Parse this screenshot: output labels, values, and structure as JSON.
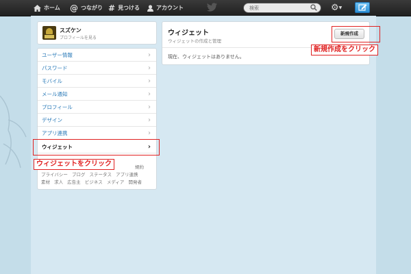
{
  "topbar": {
    "home_label": "ホーム",
    "connect_label": "つながり",
    "discover_label": "見つける",
    "account_label": "アカウント",
    "search_placeholder": "検索"
  },
  "profile": {
    "name": "スズケン",
    "link": "プロフィールを見る"
  },
  "menu": {
    "items": [
      {
        "label": "ユーザー情報"
      },
      {
        "label": "パスワード"
      },
      {
        "label": "モバイル"
      },
      {
        "label": "メール通知"
      },
      {
        "label": "プロフィール"
      },
      {
        "label": "デザイン"
      },
      {
        "label": "アプリ連携"
      },
      {
        "label": "ウィジェット"
      }
    ],
    "footer_line1": [
      "規約"
    ],
    "footer_line2": [
      "プライバシー",
      "ブログ",
      "ステータス",
      "アプリ連携"
    ],
    "footer_line3": [
      "素材",
      "求人",
      "広告主",
      "ビジネス",
      "メディア",
      "開発者"
    ]
  },
  "main": {
    "title": "ウィジェット",
    "subtitle": "ウィジェットの作成と管理",
    "empty": "現在、ウィジェットはありません。",
    "new_button": "新規作成"
  },
  "annotations": {
    "new_callout": "新規作成をクリック",
    "widget_callout": "ウィジェットをクリック"
  },
  "colors": {
    "accent_red": "#e02020",
    "link_blue": "#2a7ab8",
    "topbar": "#2b2b2b"
  }
}
